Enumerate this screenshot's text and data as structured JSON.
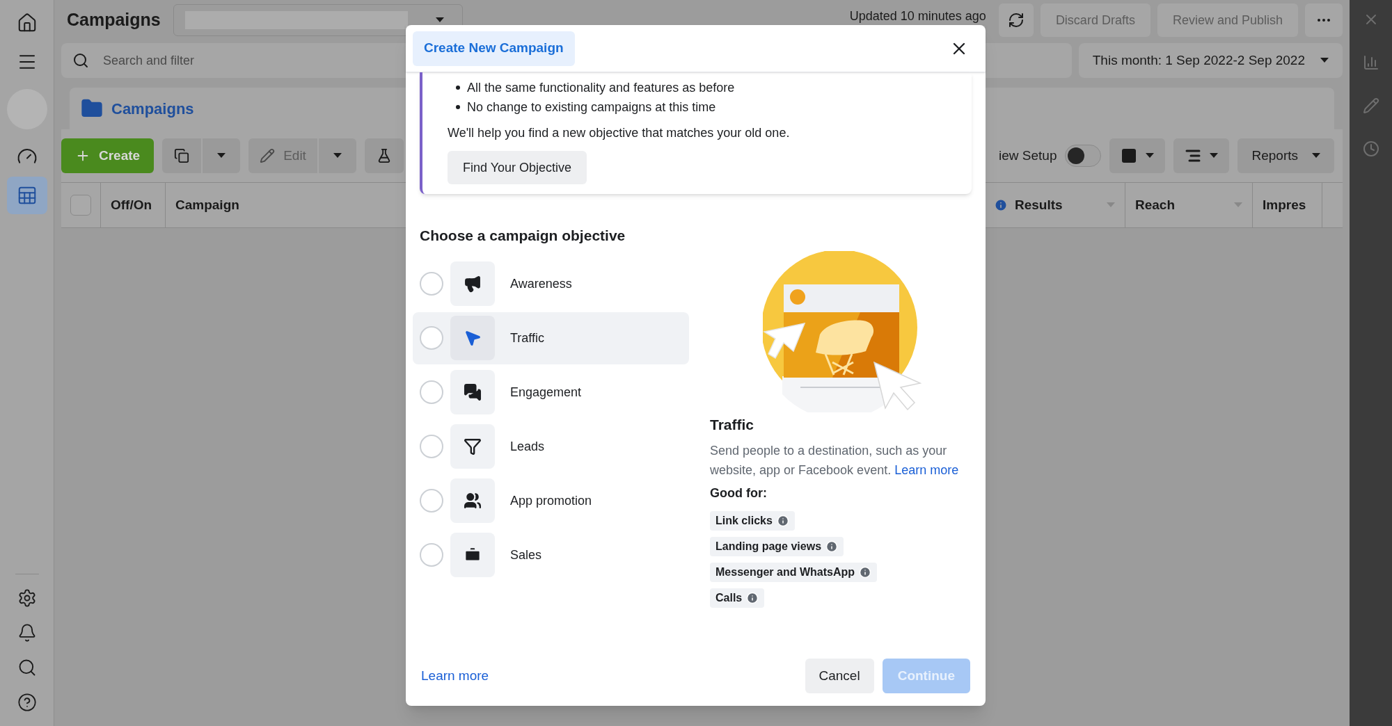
{
  "sidebar": {
    "items": [
      {
        "kind": "home",
        "selected": false
      },
      {
        "kind": "menu",
        "selected": false
      },
      {
        "kind": "avatar",
        "selected": false
      },
      {
        "kind": "gauge",
        "selected": false
      },
      {
        "kind": "table",
        "selected": true
      }
    ],
    "bottom_items": [
      {
        "kind": "settings"
      },
      {
        "kind": "bell"
      },
      {
        "kind": "search"
      },
      {
        "kind": "help"
      }
    ]
  },
  "header": {
    "title": "Campaigns",
    "updated": "Updated 10 minutes ago",
    "buttons": [
      "Discard Drafts",
      "Review and Publish"
    ]
  },
  "search": {
    "placeholder": "Search and filter"
  },
  "date_range": "This month: 1 Sep 2022-2 Sep 2022",
  "panel": {
    "tab": "Campaigns",
    "select_all_checked": false,
    "create": "Create",
    "edit": "Edit",
    "view_setup": "iew Setup",
    "view_setup_on": false,
    "reports": "Reports",
    "columns": [
      {
        "label": "Off/On",
        "info": false
      },
      {
        "label": "Campaign",
        "info": false
      },
      {
        "label": "Results",
        "info": true
      },
      {
        "label": "Reach",
        "info": false
      },
      {
        "label": "Impres",
        "info": false
      }
    ]
  },
  "right_rail": {
    "items": [
      {
        "kind": "close"
      },
      {
        "kind": "chart"
      },
      {
        "kind": "edit"
      },
      {
        "kind": "history"
      }
    ]
  },
  "dialog": {
    "tab": "Create New Campaign",
    "bullets": [
      "All the same functionality and features as before",
      "No change to existing campaigns at this time"
    ],
    "note": "We'll help you find a new objective that matches your old one.",
    "find_button": "Find Your Objective",
    "heading": "Choose a campaign objective",
    "objectives": [
      {
        "kind": "megaphone",
        "label": "Awareness",
        "selected": false,
        "highlighted": false
      },
      {
        "kind": "pointer",
        "label": "Traffic",
        "selected": false,
        "highlighted": true
      },
      {
        "kind": "chat",
        "label": "Engagement",
        "selected": false,
        "highlighted": false
      },
      {
        "kind": "funnel",
        "label": "Leads",
        "selected": false,
        "highlighted": false
      },
      {
        "kind": "people",
        "label": "App promotion",
        "selected": false,
        "highlighted": false
      },
      {
        "kind": "briefcase",
        "label": "Sales",
        "selected": false,
        "highlighted": false
      }
    ],
    "detail": {
      "title": "Traffic",
      "description": "Send people to a destination, such as your website, app or Facebook event.",
      "link": "Learn more",
      "good_for_label": "Good for:",
      "good_for": [
        "Link clicks",
        "Landing page views",
        "Messenger and WhatsApp",
        "Calls"
      ]
    },
    "learn_more": "Learn more",
    "cancel": "Cancel",
    "continue": "Continue",
    "continue_disabled": true
  }
}
